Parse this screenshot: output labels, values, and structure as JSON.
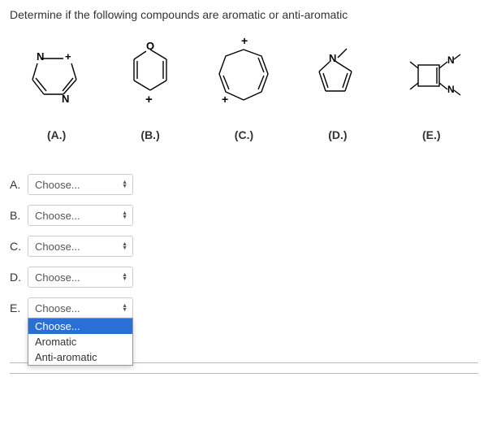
{
  "prompt": "Determine if the following compounds are aromatic or anti-aromatic",
  "compounds": [
    {
      "label": "(A.)"
    },
    {
      "label": "(B.)"
    },
    {
      "label": "(C.)"
    },
    {
      "label": "(D.)"
    },
    {
      "label": "(E.)"
    }
  ],
  "rows": [
    {
      "label": "A.",
      "value": "Choose...",
      "open": false
    },
    {
      "label": "B.",
      "value": "Choose...",
      "open": false
    },
    {
      "label": "C.",
      "value": "Choose...",
      "open": false
    },
    {
      "label": "D.",
      "value": "Choose...",
      "open": false
    },
    {
      "label": "E.",
      "value": "Choose...",
      "open": true
    }
  ],
  "options": [
    "Choose...",
    "Aromatic",
    "Anti-aromatic"
  ],
  "selected_option": "Choose...",
  "caret": "⇅"
}
